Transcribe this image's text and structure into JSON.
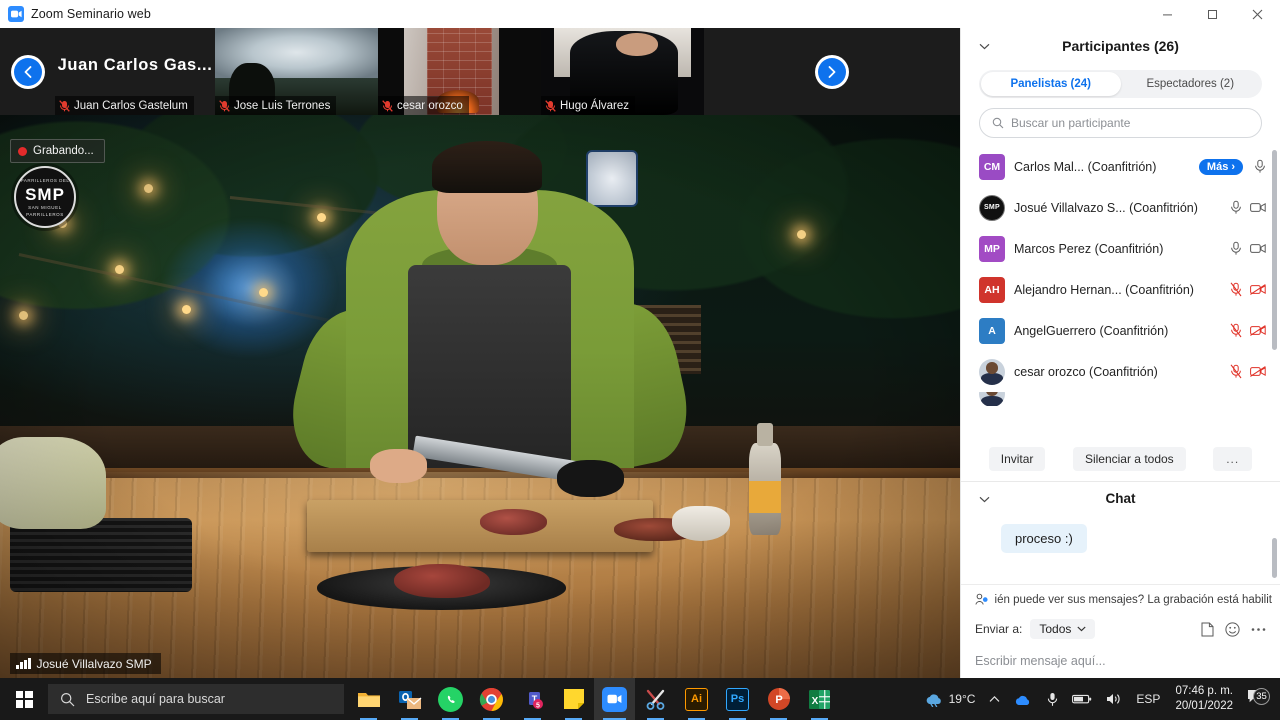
{
  "window": {
    "title": "Zoom Seminario web",
    "icon": "zoom-camera-icon",
    "minimize": "—",
    "maximize": "▢",
    "close": "✕"
  },
  "filmstrip": {
    "prev_arrow": "‹",
    "next_arrow": "›",
    "active_speaker_name": "Juan Carlos Gas...",
    "thumbnails": [
      {
        "name": "Juan Carlos Gastelum",
        "muted": true,
        "active": true
      },
      {
        "name": "Jose Luis Terrones",
        "muted": true,
        "active": false
      },
      {
        "name": "cesar orozco",
        "muted": true,
        "active": false
      },
      {
        "name": "Hugo Álvarez",
        "muted": true,
        "active": false
      }
    ]
  },
  "video": {
    "recording_label": "Grabando...",
    "speaker_label": "Josué Villalvazo SMP",
    "logo_top": "PARRILLEROS DEL",
    "logo_main": "SMP",
    "logo_sub": "SAN MIGUEL",
    "logo_bottom": "PARRILLEROS"
  },
  "participants_panel": {
    "collapse_icon": "chevron-down-icon",
    "title": "Participantes (26)",
    "tabs": [
      {
        "label": "Panelistas (24)",
        "selected": true
      },
      {
        "label": "Espectadores (2)",
        "selected": false
      }
    ],
    "search": {
      "placeholder": "Buscar un participante",
      "value": ""
    },
    "rows": [
      {
        "initials": "CM",
        "avatar_color": "#9a4bc4",
        "avatar_type": "initials",
        "name": "Carlos Mal...  (Coanfitrión)",
        "more_label": "Más",
        "more_chevron": "›",
        "mic": "mic-on",
        "cam": "none"
      },
      {
        "initials": "SMP",
        "avatar_color": "#101010",
        "avatar_type": "logo",
        "name": "Josué Villalvazo S...  (Coanfitrión)",
        "more_label": "",
        "mic": "mic-on",
        "cam": "cam-on"
      },
      {
        "initials": "MP",
        "avatar_color": "#a24bc4",
        "avatar_type": "initials",
        "name": "Marcos Perez (Coanfitrión)",
        "more_label": "",
        "mic": "mic-on",
        "cam": "cam-on"
      },
      {
        "initials": "AH",
        "avatar_color": "#d0342c",
        "avatar_type": "initials",
        "name": "Alejandro Hernan...  (Coanfitrión)",
        "more_label": "",
        "mic": "mic-off",
        "cam": "cam-off"
      },
      {
        "initials": "A",
        "avatar_color": "#2d7dc4",
        "avatar_type": "initials",
        "name": "AngelGuerrero (Coanfitrión)",
        "more_label": "",
        "mic": "mic-off",
        "cam": "cam-off"
      },
      {
        "initials": "",
        "avatar_color": "#c9d2dc",
        "avatar_type": "photo",
        "name": "cesar orozco (Coanfitrión)",
        "more_label": "",
        "mic": "mic-off",
        "cam": "cam-off"
      }
    ],
    "actions": {
      "invite": "Invitar",
      "mute_all": "Silenciar a todos",
      "more": "..."
    }
  },
  "chat_panel": {
    "collapse_icon": "chevron-down-icon",
    "title": "Chat",
    "messages": [
      {
        "text": "proceso :)"
      }
    ],
    "notice": "ién puede ver sus mensajes? La grabación está habilit",
    "send_to_label": "Enviar a:",
    "send_to_value": "Todos",
    "send_to_chevron": "⌄",
    "icons": [
      "file-icon",
      "emoji-icon",
      "more-icon"
    ],
    "input_placeholder": "Escribir mensaje aquí..."
  },
  "taskbar": {
    "start": "windows-start-icon",
    "search_placeholder": "Escribe aquí para buscar",
    "apps": [
      {
        "name": "file-explorer",
        "label": "",
        "color": "#f7b731",
        "open": true
      },
      {
        "name": "outlook",
        "label": "O",
        "color": "#0a63b0",
        "open": true
      },
      {
        "name": "whatsapp",
        "label": "",
        "color": "#25d366",
        "open": true
      },
      {
        "name": "chrome",
        "label": "",
        "color": "#e34133",
        "open": true
      },
      {
        "name": "teams",
        "label": "T",
        "color": "#5059c9",
        "open": true
      },
      {
        "name": "sticky-notes",
        "label": "",
        "color": "#ffd72e",
        "open": true
      },
      {
        "name": "zoom",
        "label": "",
        "color": "#2d8cff",
        "active": true
      },
      {
        "name": "snipping-tool",
        "label": "",
        "color": "#e8e8e8",
        "open": true
      },
      {
        "name": "illustrator",
        "label": "Ai",
        "color": "#ff9a00",
        "open": true
      },
      {
        "name": "photoshop",
        "label": "Ps",
        "color": "#31a8ff",
        "open": true
      },
      {
        "name": "powerpoint",
        "label": "P",
        "color": "#d24726",
        "open": true
      },
      {
        "name": "excel",
        "label": "X",
        "color": "#107c41",
        "open": true
      }
    ],
    "tray": {
      "weather_icon": "cloud-icon",
      "weather": "19°C",
      "chevron": "⌃",
      "onedrive_icon": "onedrive-icon",
      "mic_icon": "microphone-icon",
      "battery_icon": "battery-icon",
      "volume_icon": "volume-icon",
      "language": "ESP",
      "time": "07:46 p. m.",
      "date": "20/01/2022",
      "notifications": "35"
    }
  }
}
